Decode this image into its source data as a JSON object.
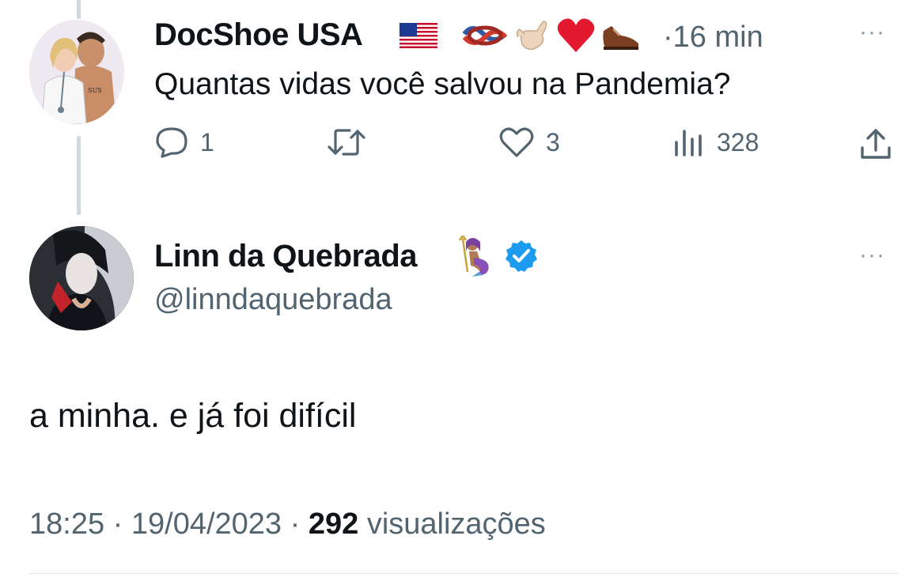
{
  "tweet1": {
    "display_name": "DocShoe USA",
    "name_emojis": [
      "🇺🇸",
      "🪢",
      "🤙🏻",
      "❤️",
      "👞"
    ],
    "separator": "·",
    "time": "16 min",
    "more": "···",
    "text": "Quantas vidas você salvou na Pandemia?",
    "actions": {
      "replies": "1",
      "likes": "3",
      "views": "328"
    }
  },
  "tweet2": {
    "display_name": "Linn da Quebrada",
    "name_emoji": "🧜🏽‍♀️",
    "verified_icon": "verified-badge-icon",
    "handle": "@linndaquebrada",
    "more": "···",
    "text": "a minha. e já foi difícil",
    "time": "18:25",
    "separator": "·",
    "date": "19/04/2023",
    "views_count": "292",
    "views_label": "visualizações"
  },
  "colors": {
    "text_primary": "#0f1419",
    "text_secondary": "#536471",
    "verified_blue": "#1d9bf0",
    "thread_line": "#cfd9de"
  }
}
